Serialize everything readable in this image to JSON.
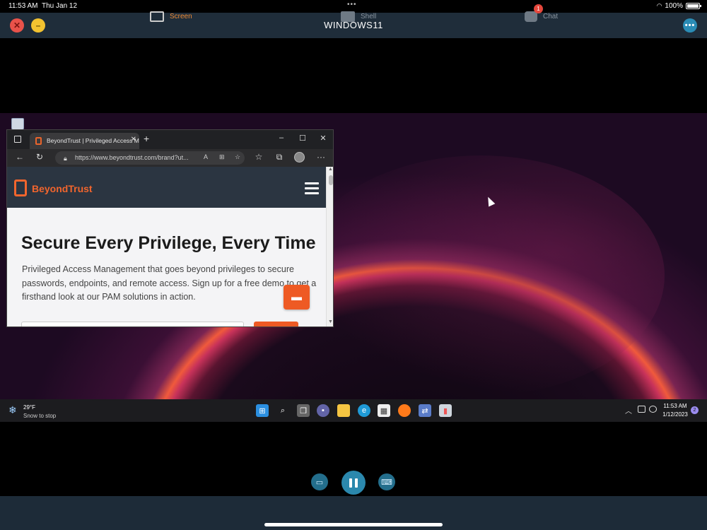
{
  "status_bar": {
    "time": "11:53 AM",
    "date": "Thu Jan 12",
    "battery": "100%",
    "battery_level": 1.0
  },
  "app_bar": {
    "title": "WINDOWS11"
  },
  "browser": {
    "tab_title": "BeyondTrust | Privileged Access M",
    "url": "https://www.beyondtrust.com/brand?ut...",
    "window_controls": {
      "minimize": "–",
      "maximize": "☐",
      "close": "✕"
    },
    "nav": {
      "back": "←",
      "refresh": "↻",
      "more": "···"
    },
    "page": {
      "logo_text": "BeyondTrust",
      "hero_title": "Secure Every Privilege, Every Time",
      "hero_body": "Privileged Access Management that goes beyond privileges to secure passwords, endpoints, and remote access. Sign up for a free demo to get a firsthand look at our PAM solutions in action."
    }
  },
  "taskbar": {
    "weather_temp": "29°F",
    "weather_desc": "Snow to stop",
    "clock_time": "11:53 AM",
    "clock_date": "1/12/2023",
    "notification_count": "2",
    "apps": [
      "start",
      "search",
      "task-view",
      "teams",
      "file-explorer",
      "edge",
      "store",
      "firefox",
      "network-tool",
      "remote-app"
    ]
  },
  "bottom_tabs": {
    "screen": "Screen",
    "shell": "Shell",
    "chat": "Chat",
    "chat_badge": "1"
  },
  "colors": {
    "accent_orange": "#ee5a24",
    "app_bar": "#1f2d3a",
    "active_tab": "#ee8a35"
  }
}
